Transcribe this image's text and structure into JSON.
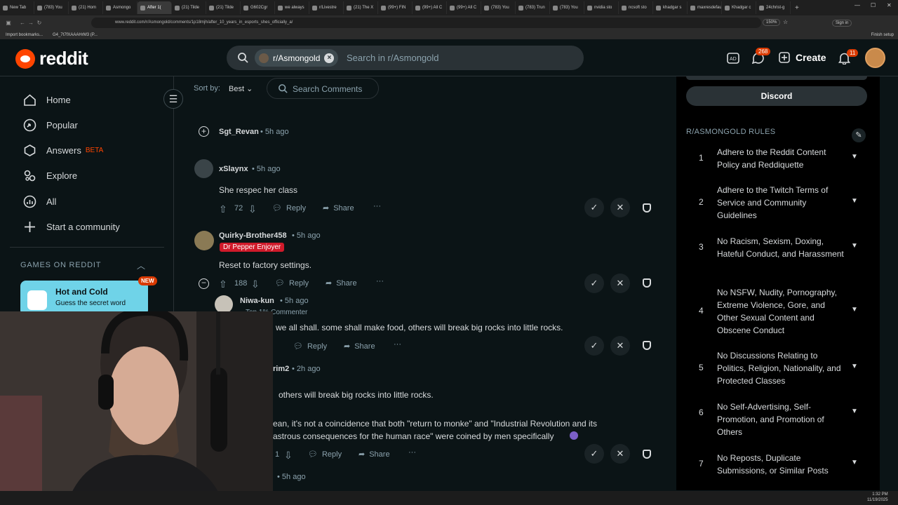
{
  "browser": {
    "tabs": [
      "New Tab",
      "(783) You",
      "(21) Hom",
      "Asmongo",
      "After 1(",
      "(21) Tilde",
      "(21) Tilde",
      "G602Cgr",
      "we always",
      "r/Livestre",
      "(21) The X",
      "(99+) FIN",
      "(99+) All C",
      "(99+) All C",
      "(783) You",
      "(783) Trun",
      "(783) You",
      "nvidia sto",
      "ncsoft sto",
      "khadgar s",
      "maxresdefault",
      "Khadgar c",
      "24christ-g"
    ],
    "url": "www.reddit.com/r/Asmongold/comments/1p18mjh/after_10_years_in_esports_shes_officially_a/",
    "zoom": "150%",
    "sign_in": "Sign in",
    "finish_setup": "Finish setup",
    "bookmarks": [
      "Import bookmarks...",
      "G4_7t7fXAAAHrM3 (P..."
    ]
  },
  "header": {
    "logo": "reddit",
    "subreddit_chip": "r/Asmongold",
    "search_placeholder": "Search in r/Asmongold",
    "chat_badge": "268",
    "create": "Create",
    "notif_badge": "11"
  },
  "leftnav": {
    "items": [
      "Home",
      "Popular",
      "Answers",
      "Explore",
      "All",
      "Start a community"
    ],
    "beta": "BETA",
    "games_header": "GAMES ON REDDIT",
    "game_title": "Hot and Cold",
    "game_sub": "Guess the secret word",
    "game_badge": "NEW"
  },
  "main": {
    "sort_label": "Sort by:",
    "sort_value": "Best",
    "search_comments": "Search Comments",
    "reply": "Reply",
    "share": "Share",
    "comments": [
      {
        "user": "Sgt_Revan",
        "time": "5h ago"
      },
      {
        "user": "xSlaynx",
        "time": "5h ago",
        "body": "She respec her class",
        "votes": "72"
      },
      {
        "user": "Quirky-Brother458",
        "time": "5h ago",
        "flair": "Dr Pepper Enjoyer",
        "body": "Reset to factory settings.",
        "votes": "188"
      },
      {
        "user": "Niwa-kun",
        "time": "5h ago",
        "flair": "Top 1% Commenter",
        "body": "we all shall. some shall make food, others will break big rocks into little rocks."
      },
      {
        "user": "rim2",
        "time": "2h ago",
        "body1": "others will break big rocks into little rocks.",
        "body2": "ean, it's not a coincidence that both \"return to monke\" and \"Industrial Revolution and its",
        "body3": "astrous consequences for the human race\" were coined by men specifically",
        "votes": "1"
      },
      {
        "time": "5h ago"
      }
    ]
  },
  "rightside": {
    "discord": "Discord",
    "rules_header": "R/ASMONGOLD RULES",
    "rules": [
      {
        "n": "1",
        "text": "Adhere to the Reddit Content Policy and Reddiquette"
      },
      {
        "n": "2",
        "text": "Adhere to the Twitch Terms of Service and Community Guidelines"
      },
      {
        "n": "3",
        "text": "No Racism, Sexism, Doxing, Hateful Conduct, and Harassment"
      },
      {
        "n": "4",
        "text": "No NSFW, Nudity, Pornography, Extreme Violence, Gore, and Other Sexual Content and Obscene Conduct"
      },
      {
        "n": "5",
        "text": "No Discussions Relating to Politics, Religion, Nationality, and Protected Classes"
      },
      {
        "n": "6",
        "text": "No Self-Advertising, Self-Promotion, and Promotion of Others"
      },
      {
        "n": "7",
        "text": "No Reposts, Duplicate Submissions, or Similar Posts"
      }
    ]
  },
  "taskbar": {
    "time": "1:32 PM",
    "date": "11/19/2025"
  }
}
